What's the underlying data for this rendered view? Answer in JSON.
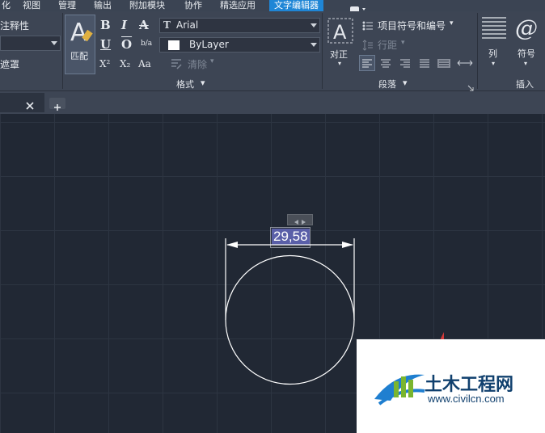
{
  "menubar": {
    "items": [
      "化",
      "视图",
      "管理",
      "输出",
      "附加模块",
      "协作",
      "精选应用",
      "文字编辑器"
    ],
    "active": "文字编辑器"
  },
  "ribbon": {
    "annotative_label": "注释性",
    "mask_label": "遮罩",
    "match_label": "匹配",
    "format_buttons": {
      "bold": "B",
      "italic": "I",
      "strike": "A",
      "underline": "U",
      "overline": "O",
      "stack": "b/a",
      "superscript": "X²",
      "subscript": "X₂",
      "case": "Aa"
    },
    "font_value": "Arial",
    "color_value": "ByLayer",
    "clear_label": "清除",
    "format_panel_title": "格式",
    "justify_label": "对正",
    "bullets_label": "项目符号和编号",
    "line_spacing_label": "行距",
    "paragraph_panel_title": "段落",
    "columns_label": "列",
    "symbol_label": "符号",
    "symbol_glyph": "@",
    "insert_panel_title": "插入"
  },
  "drawing": {
    "dimension_value": "29,58"
  },
  "watermark": {
    "site_name": "土木工程网",
    "url": "www.civilcn.com"
  },
  "colors": {
    "accent": "#1f86d6",
    "canvas": "#212834",
    "dimension_highlight": "#5a5fa8"
  }
}
